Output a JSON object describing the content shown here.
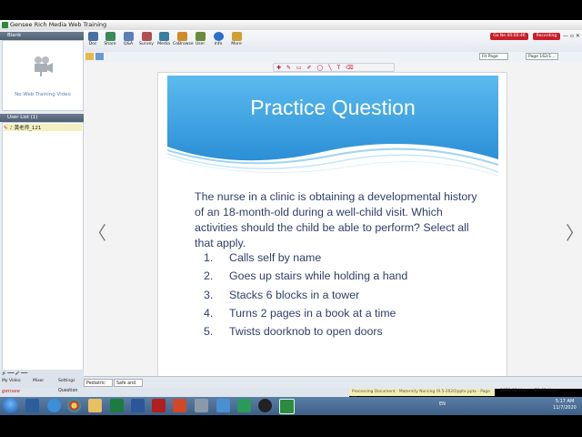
{
  "window": {
    "title": "Gensee Rich Media Web Training"
  },
  "left_panel": {
    "video_header": "Blank",
    "no_video_text": "No Web Training Video",
    "user_list_header": "User List (1)",
    "user_name": "黄老师_121",
    "controls": {
      "my_video": "My Video",
      "mixer": "Mixer",
      "settings": "Settings",
      "question": "Question"
    }
  },
  "toolbar": {
    "items": [
      {
        "label": "Doc",
        "icon": "doc-icon",
        "color": "#4a6fa5"
      },
      {
        "label": "Share",
        "icon": "share-icon",
        "color": "#3b8a5a"
      },
      {
        "label": "Q&A",
        "icon": "qa-icon",
        "color": "#5a7fb5"
      },
      {
        "label": "Survey",
        "icon": "survey-icon",
        "color": "#b05050"
      },
      {
        "label": "Media",
        "icon": "media-icon",
        "color": "#3b7f9e"
      },
      {
        "label": "CoBrowse",
        "icon": "cobrowse-icon",
        "color": "#d08a2a"
      },
      {
        "label": "User",
        "icon": "user-icon",
        "color": "#6b8a3a"
      },
      {
        "label": "Info",
        "icon": "info-icon",
        "color": "#2a6fc9"
      },
      {
        "label": "More",
        "icon": "more-icon",
        "color": "#d0a030"
      }
    ],
    "stop_label": "Go Ne 00:00:46",
    "record_label": "Recording",
    "fit_pages": "Fit Page",
    "page_indicator": "Page 162/1..."
  },
  "slide": {
    "title": "Practice Question",
    "question": "The nurse in a clinic is obtaining a developmental history of an 18-month-old during a well-child visit.  Which activities should the child be able to perform?  Select all that apply.",
    "options": [
      {
        "num": "1.",
        "text": "Calls self by name"
      },
      {
        "num": "2.",
        "text": "Goes up stairs while holding a hand"
      },
      {
        "num": "3.",
        "text": "Stacks 6 blocks in a tower"
      },
      {
        "num": "4.",
        "text": "Turns 2 pages in a book at a time"
      },
      {
        "num": "5.",
        "text": "Twists doorknob to open doors"
      }
    ],
    "header_color": "#3a9fdc"
  },
  "nav": {
    "prev": "〈",
    "next": "〉"
  },
  "doc_tabs": [
    "Pediatric N...",
    "Safe and bf..."
  ],
  "status_bar": {
    "processing": "Processing Document : Maternity Nursing (9.5-2020)pptx.pptx - Page 92...",
    "upload_rate": "1625.08 kbps",
    "download_rate": "23.01 kbps"
  },
  "brand": "gensee",
  "taskbar": {
    "language": "EN",
    "time": "5:17 AM",
    "date": "11/7/2020"
  }
}
